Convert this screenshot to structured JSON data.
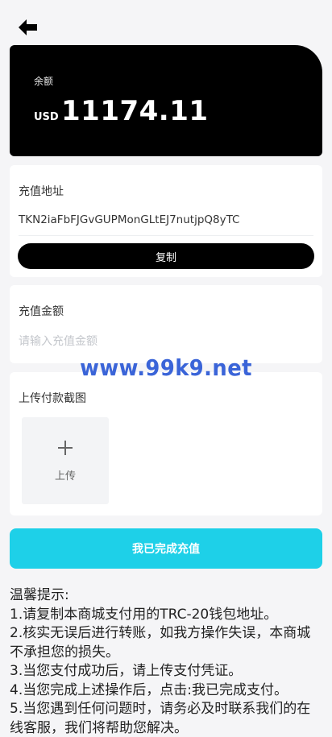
{
  "header": {
    "back_icon": "arrow-left-icon"
  },
  "balance": {
    "label": "余额",
    "currency": "USD",
    "amount": "11174.11"
  },
  "address_section": {
    "title": "充值地址",
    "address": "TKN2iaFbFJGvGUPMonGLtEJ7nutjpQ8yTC",
    "copy_label": "复制"
  },
  "amount_section": {
    "title": "充值金额",
    "placeholder": "请输入充值金额",
    "value": ""
  },
  "upload_section": {
    "title": "上传付款截图",
    "upload_label": "上传",
    "upload_icon": "plus-icon"
  },
  "submit": {
    "label": "我已完成充值",
    "color": "#1ed0e8"
  },
  "notes": {
    "title": "温馨提示:",
    "lines": [
      "1.请复制本商城支付用的TRC-20钱包地址。",
      "2.核实无误后进行转账，如我方操作失误，本商城不承担您的损失。",
      "3.当您支付成功后，请上传支付凭证。",
      "4.当您完成上述操作后，点击:我已完成支付。",
      "5.当您遇到任何问题时，请务必及时联系我们的在线客服，我们将帮助您解决。"
    ]
  },
  "watermark": {
    "text": "www.99k9.net"
  }
}
